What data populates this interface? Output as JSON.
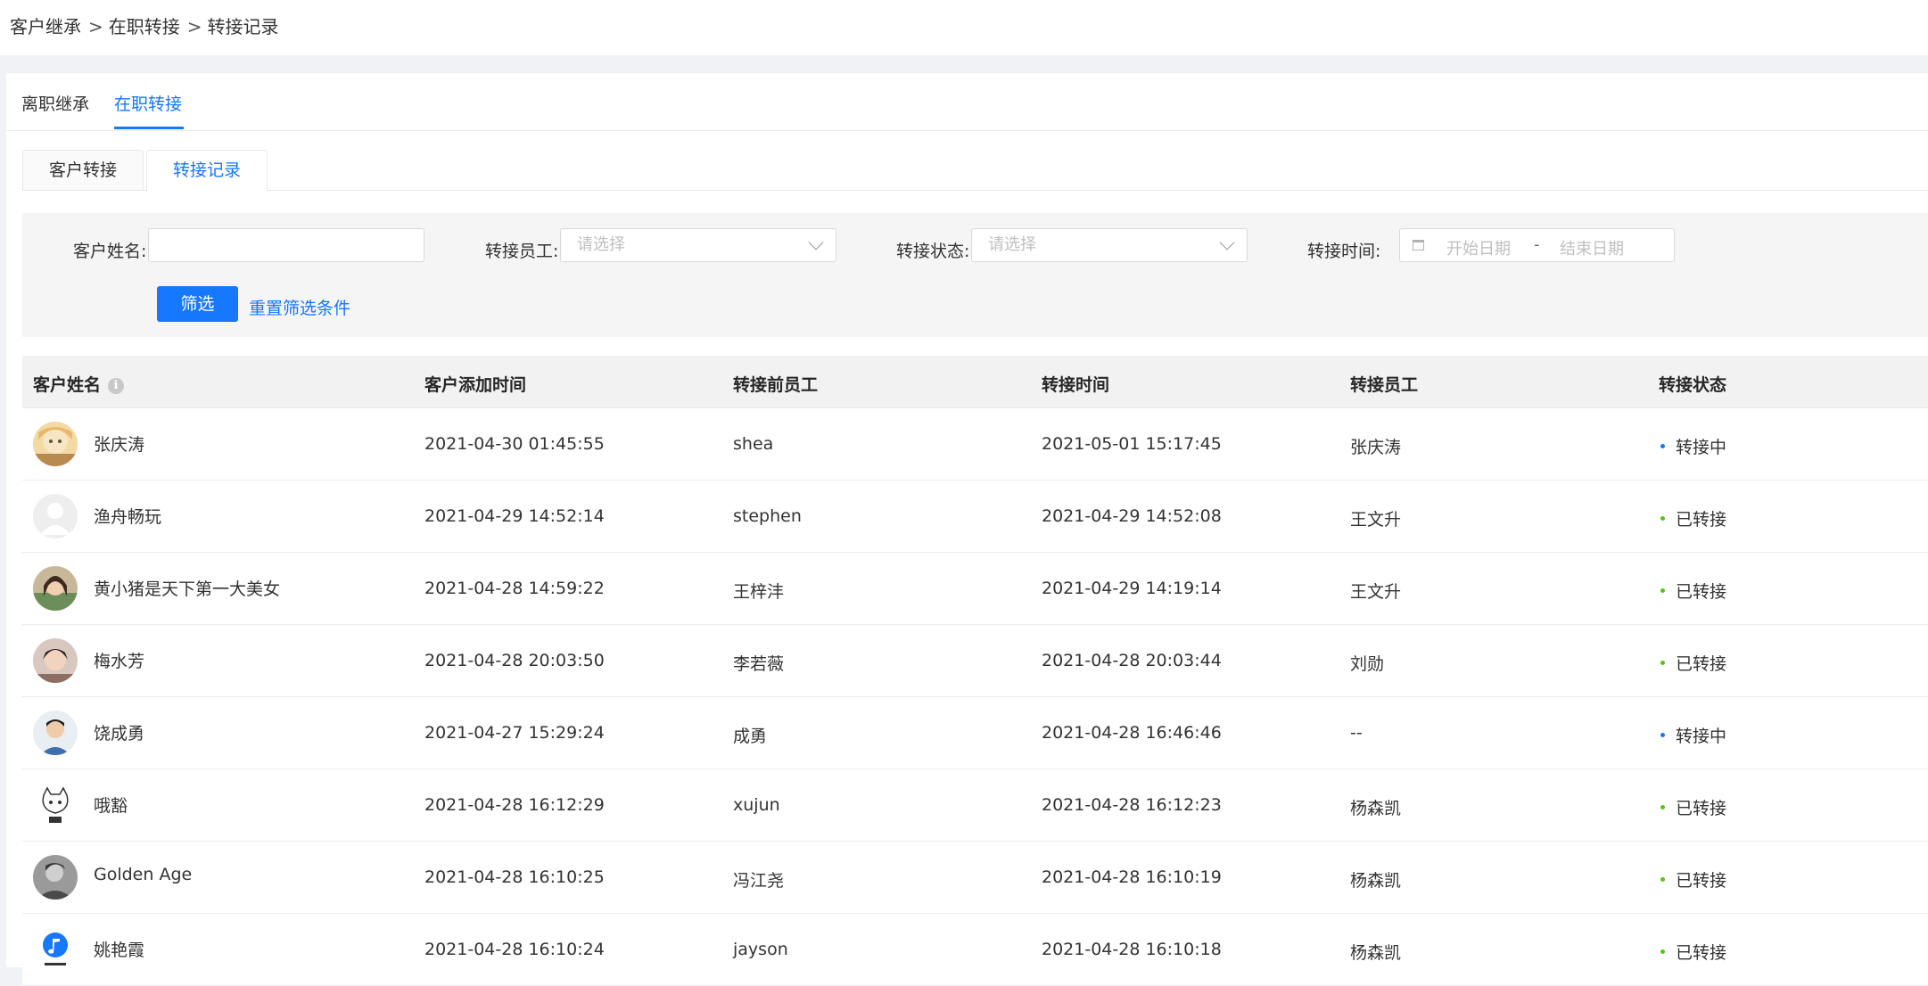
{
  "breadcrumb": [
    "客户继承",
    "在职转接",
    "转接记录"
  ],
  "breadcrumb_separator": ">",
  "tabs": [
    {
      "label": "离职继承",
      "active": false
    },
    {
      "label": "在职转接",
      "active": true
    }
  ],
  "subtabs": [
    {
      "label": "客户转接",
      "active": false
    },
    {
      "label": "转接记录",
      "active": true
    }
  ],
  "filter": {
    "customer_name_label": "客户姓名:",
    "customer_name_value": "",
    "employee_label": "转接员工:",
    "employee_placeholder": "请选择",
    "status_label": "转接状态:",
    "status_placeholder": "请选择",
    "time_label": "转接时间:",
    "start_placeholder": "开始日期",
    "range_separator": "-",
    "end_placeholder": "结束日期",
    "submit_label": "筛选",
    "reset_label": "重置筛选条件"
  },
  "table": {
    "columns": [
      "客户姓名",
      "客户添加时间",
      "转接前员工",
      "转接时间",
      "转接员工",
      "转接状态"
    ],
    "info_icon_glyph": "i",
    "rows": [
      {
        "name": "张庆涛",
        "avatar": "photo-cartoon-girl",
        "added": "2021-04-30 01:45:55",
        "from": "shea",
        "time": "2021-05-01 15:17:45",
        "to": "张庆涛",
        "status": "转接中",
        "status_color": "#1677ff"
      },
      {
        "name": "渔舟畅玩",
        "avatar": "default-user-icon",
        "added": "2021-04-29 14:52:14",
        "from": "stephen",
        "time": "2021-04-29 14:52:08",
        "to": "王文升",
        "status": "已转接",
        "status_color": "#52c41a"
      },
      {
        "name": "黄小猪是天下第一大美女",
        "avatar": "photo-girl",
        "added": "2021-04-28 14:59:22",
        "from": "王梓沣",
        "time": "2021-04-29 14:19:14",
        "to": "王文升",
        "status": "已转接",
        "status_color": "#52c41a"
      },
      {
        "name": "梅水芳",
        "avatar": "photo-woman",
        "added": "2021-04-28 20:03:50",
        "from": "李若薇",
        "time": "2021-04-28 20:03:44",
        "to": "刘勋",
        "status": "已转接",
        "status_color": "#52c41a"
      },
      {
        "name": "饶成勇",
        "avatar": "photo-man",
        "added": "2021-04-27 15:29:24",
        "from": "成勇",
        "time": "2021-04-28 16:46:46",
        "to": "--",
        "status": "转接中",
        "status_color": "#1677ff"
      },
      {
        "name": "哦豁",
        "avatar": "cartoon-cat",
        "added": "2021-04-28 16:12:29",
        "from": "xujun",
        "time": "2021-04-28 16:12:23",
        "to": "杨森凯",
        "status": "已转接",
        "status_color": "#52c41a"
      },
      {
        "name": "Golden Age",
        "avatar": "photo-bw-man",
        "added": "2021-04-28 16:10:25",
        "from": "冯江尧",
        "time": "2021-04-28 16:10:19",
        "to": "杨森凯",
        "status": "已转接",
        "status_color": "#52c41a"
      },
      {
        "name": "姚艳霞",
        "avatar": "logo-blue-note",
        "added": "2021-04-28 16:10:24",
        "from": "jayson",
        "time": "2021-04-28 16:10:18",
        "to": "杨森凯",
        "status": "已转接",
        "status_color": "#52c41a"
      }
    ]
  },
  "colors": {
    "accent": "#1677ff",
    "status_in_progress": "#1677ff",
    "status_done": "#52c41a"
  }
}
